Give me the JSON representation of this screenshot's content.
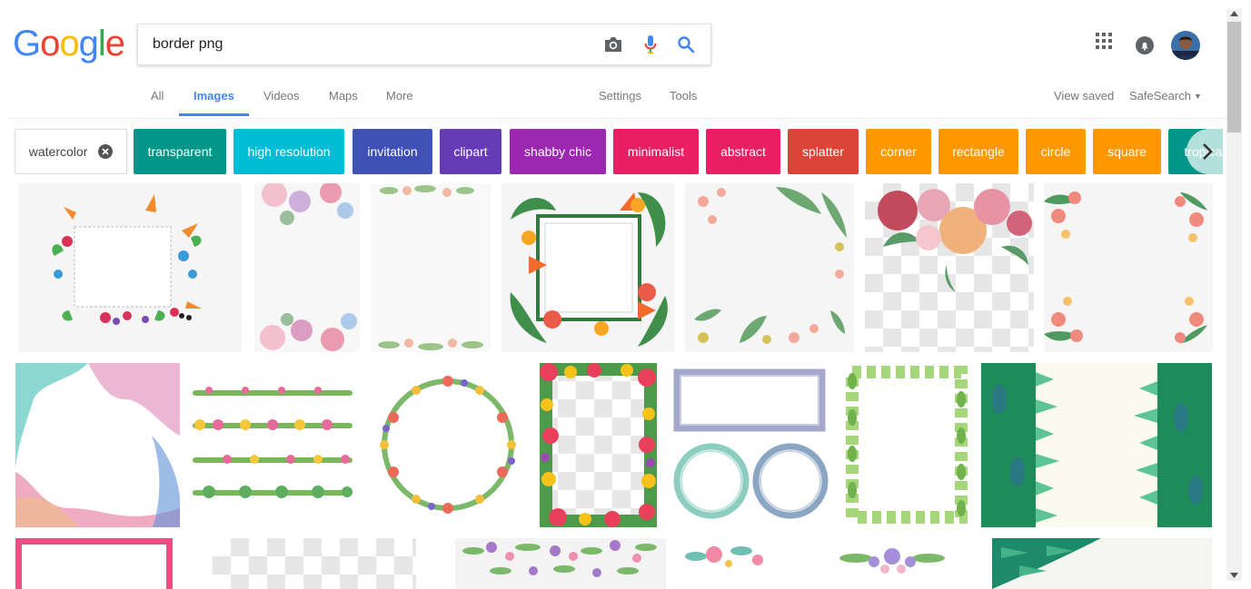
{
  "logo": {
    "letters": [
      "G",
      "o",
      "o",
      "g",
      "l",
      "e"
    ],
    "colors": [
      "#4285f4",
      "#ea4335",
      "#fbbc05",
      "#4285f4",
      "#34a853",
      "#ea4335"
    ]
  },
  "search": {
    "query": "border png",
    "camera_icon": "camera-icon",
    "mic_icon": "microphone-icon",
    "search_icon": "search-icon"
  },
  "tabs": [
    {
      "label": "All",
      "active": false
    },
    {
      "label": "Images",
      "active": true
    },
    {
      "label": "Videos",
      "active": false
    },
    {
      "label": "Maps",
      "active": false
    },
    {
      "label": "More",
      "active": false
    },
    {
      "label": "Settings",
      "active": false
    },
    {
      "label": "Tools",
      "active": false
    }
  ],
  "right_links": {
    "view_saved": "View saved",
    "safesearch": "SafeSearch"
  },
  "chips": [
    {
      "label": "watercolor",
      "color": "#ffffff"
    },
    {
      "label": "transparent",
      "color": "#009688"
    },
    {
      "label": "high resolution",
      "color": "#00bcd4"
    },
    {
      "label": "invitation",
      "color": "#3f51b5"
    },
    {
      "label": "clipart",
      "color": "#673ab7"
    },
    {
      "label": "shabby chic",
      "color": "#9c27b0"
    },
    {
      "label": "minimalist",
      "color": "#e91e63"
    },
    {
      "label": "abstract",
      "color": "#e91e63"
    },
    {
      "label": "splatter",
      "color": "#db4437"
    },
    {
      "label": "corner",
      "color": "#ff9800"
    },
    {
      "label": "rectangle",
      "color": "#ff9800"
    },
    {
      "label": "circle",
      "color": "#ff9800"
    },
    {
      "label": "square",
      "color": "#ff9800"
    },
    {
      "label": "tropical",
      "color": "#009688"
    }
  ],
  "thumbnails": [
    {
      "style": "floral-square-frame"
    },
    {
      "style": "floral-corners"
    },
    {
      "style": "floral-top-bottom"
    },
    {
      "style": "tropical-square-frame"
    },
    {
      "style": "leaf-border"
    },
    {
      "style": "rose-bouquet-transparent"
    },
    {
      "style": "floral-corners"
    },
    {
      "style": "watercolor-splash"
    },
    {
      "style": "floral-strips"
    },
    {
      "style": "floral-wreath"
    },
    {
      "style": "floral-transparent-frame"
    },
    {
      "style": "brush-frames-circles"
    },
    {
      "style": "leaf-frame"
    },
    {
      "style": "green-leaf-sides"
    },
    {
      "style": "pink-brush-frame"
    },
    {
      "style": "transparent"
    },
    {
      "style": "floral-strip"
    },
    {
      "style": "floral-small"
    },
    {
      "style": "lavender-floral"
    },
    {
      "style": "green-leaf-corner"
    }
  ]
}
